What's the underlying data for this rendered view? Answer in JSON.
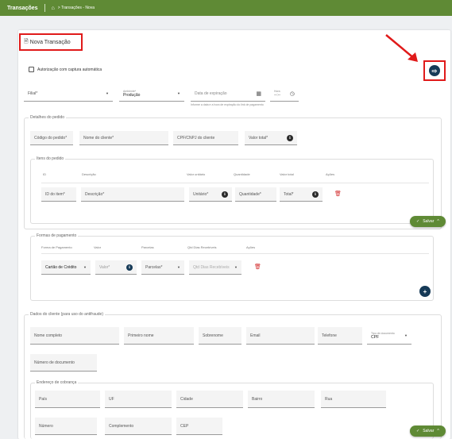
{
  "topbar": {
    "title": "Transações",
    "home_icon": "home-icon",
    "breadcrumb": "> Transações - Nova"
  },
  "page": {
    "title": "Nova Transação",
    "title_icon": "document-icon",
    "action_icon": "add-card-icon",
    "highlight_color": "#e01a1a"
  },
  "form": {
    "auto_capture_label": "Autorização com captura automática",
    "filial_label": "Filial*",
    "ambiente_label": "Ambiente*",
    "ambiente_value": "Produção",
    "expiration_placeholder": "Data de expiração",
    "time_label": "Hora",
    "time_value": "--:--",
    "expiration_hint": "Informe a data e a hora de expiração do link de pagamento"
  },
  "order": {
    "legend": "Detalhes do pedido",
    "codigo": "Código do pedido*",
    "nome": "Nome do cliente*",
    "cpf": "CPF/CNPJ do cliente",
    "valor_total": "Valor total*"
  },
  "items": {
    "legend": "Itens do pedido",
    "headers": [
      "ID",
      "Descrição",
      "Valor unitário",
      "Quantidade",
      "Valor total",
      "Ações"
    ],
    "id": "ID do item*",
    "descricao": "Descrição*",
    "unitario": "Unitário*",
    "quantidade": "Quantidade*",
    "total": "Total*"
  },
  "payments": {
    "legend": "Formas de pagamento",
    "headers": [
      "Forma de Pagamento",
      "Valor",
      "Parcelas",
      "Qtd Dias Recebíveis",
      "Ações"
    ],
    "forma": "Cartão de Crédito",
    "valor": "Valor*",
    "parcelas": "Parcelas*",
    "dias": "Qtd Dias Recebíveis"
  },
  "client": {
    "legend": "Dados do cliente (para uso do antifraude)",
    "nome_completo": "Nome completo",
    "primeiro_nome": "Primeiro nome",
    "sobrenome": "Sobrenome",
    "email": "Email",
    "telefone": "Telefone",
    "tipo_label": "Tipo de documento",
    "tipo_value": "CPF",
    "numero_documento": "Número de documento"
  },
  "billing": {
    "legend": "Endereço de cobrança",
    "pais": "País",
    "uf": "UF",
    "cidade": "Cidade",
    "bairro": "Bairro",
    "rua": "Rua",
    "numero": "Número",
    "complemento": "Complemento",
    "cep": "CEP"
  },
  "save_label": "Salvar",
  "colors": {
    "brand": "#5f8a35",
    "fab": "#163a57",
    "delete": "#d32f2f"
  }
}
